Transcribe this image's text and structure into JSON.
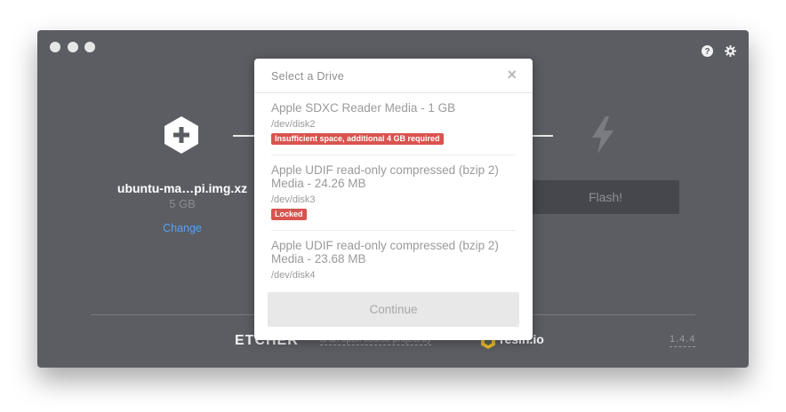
{
  "window": {
    "traffic_lights": [
      "close",
      "minimize",
      "zoom"
    ]
  },
  "toolbar": {
    "help_icon": "question-circle-icon",
    "settings_icon": "gear-icon"
  },
  "image_step": {
    "icon": "plus-hexagon-icon",
    "filename": "ubuntu-ma…pi.img.xz",
    "size": "5 GB",
    "change_label": "Change"
  },
  "flash_step": {
    "icon": "lightning-bolt-icon",
    "button_label": "Flash!"
  },
  "footer": {
    "brand": "ETCHER",
    "subtitle": "is an open source project by",
    "partner": "resin.io",
    "version": "1.4.4"
  },
  "modal": {
    "title": "Select a Drive",
    "close_glyph": "×",
    "drives": [
      {
        "name": "Apple SDXC Reader Media - 1 GB",
        "path": "/dev/disk2",
        "badge": "Insufficient space, additional 4 GB required"
      },
      {
        "name": "Apple UDIF read-only compressed (bzip 2) Media - 24.26 MB",
        "path": "/dev/disk3",
        "badge": "Locked"
      },
      {
        "name": "Apple UDIF read-only compressed (bzip 2) Media - 23.68 MB",
        "path": "/dev/disk4",
        "badge": ""
      }
    ],
    "continue_label": "Continue"
  },
  "colors": {
    "window_bg": "#5b5d63",
    "link": "#5aa0ef",
    "badge": "#d9534f",
    "resin": "#e8b923"
  }
}
